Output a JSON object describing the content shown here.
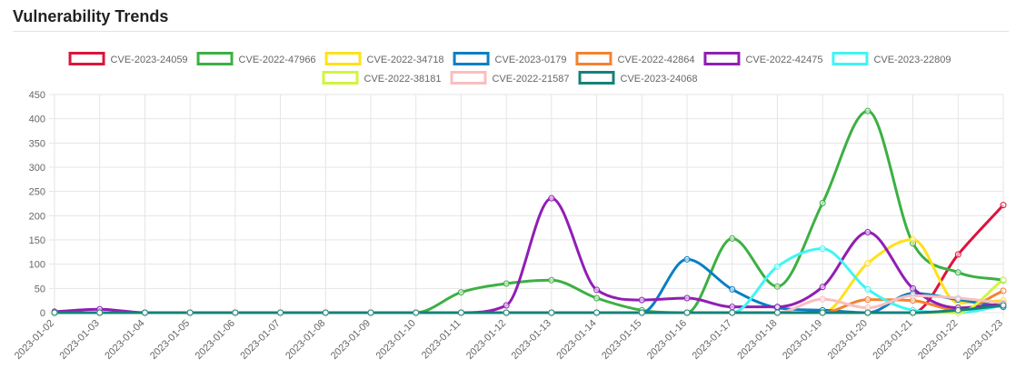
{
  "page": {
    "title": "Vulnerability Trends"
  },
  "chart_data": {
    "type": "line",
    "title": "Vulnerability Trends",
    "xlabel": "",
    "ylabel": "",
    "ylim": [
      0,
      450
    ],
    "yticks": [
      0,
      50,
      100,
      150,
      200,
      250,
      300,
      350,
      400,
      450
    ],
    "grid": true,
    "legend_position": "top",
    "x": [
      "2023-01-02",
      "2023-01-03",
      "2023-01-04",
      "2023-01-05",
      "2023-01-06",
      "2023-01-07",
      "2023-01-08",
      "2023-01-09",
      "2023-01-10",
      "2023-01-11",
      "2023-01-12",
      "2023-01-13",
      "2023-01-14",
      "2023-01-15",
      "2023-01-16",
      "2023-01-17",
      "2023-01-18",
      "2023-01-19",
      "2023-01-20",
      "2023-01-21",
      "2023-01-22",
      "2023-01-23"
    ],
    "series": [
      {
        "name": "CVE-2023-24059",
        "color": "#dc143c",
        "values": [
          0,
          0,
          0,
          0,
          0,
          0,
          0,
          0,
          0,
          0,
          0,
          0,
          0,
          0,
          0,
          0,
          0,
          0,
          0,
          0,
          120,
          222
        ]
      },
      {
        "name": "CVE-2022-47966",
        "color": "#3cb043",
        "values": [
          0,
          0,
          0,
          0,
          0,
          0,
          0,
          0,
          0,
          42,
          60,
          67,
          30,
          5,
          0,
          153,
          54,
          226,
          416,
          143,
          83,
          67
        ]
      },
      {
        "name": "CVE-2022-34718",
        "color": "#ffe119",
        "values": [
          0,
          0,
          0,
          0,
          0,
          0,
          0,
          0,
          0,
          0,
          0,
          0,
          0,
          0,
          0,
          0,
          0,
          0,
          102,
          151,
          20,
          25
        ]
      },
      {
        "name": "CVE-2023-0179",
        "color": "#0a7fc2",
        "values": [
          0,
          0,
          0,
          0,
          0,
          0,
          0,
          0,
          0,
          0,
          0,
          0,
          0,
          0,
          110,
          48,
          10,
          5,
          0,
          40,
          27,
          12
        ]
      },
      {
        "name": "CVE-2022-42864",
        "color": "#f58231",
        "values": [
          0,
          0,
          0,
          0,
          0,
          0,
          0,
          0,
          0,
          0,
          0,
          0,
          0,
          0,
          0,
          0,
          0,
          0,
          27,
          25,
          5,
          45
        ]
      },
      {
        "name": "CVE-2022-42475",
        "color": "#911eb4",
        "values": [
          2,
          7,
          0,
          0,
          0,
          0,
          0,
          0,
          0,
          0,
          15,
          236,
          47,
          26,
          30,
          12,
          12,
          53,
          166,
          50,
          10,
          18
        ]
      },
      {
        "name": "CVE-2023-22809",
        "color": "#42f4f4",
        "values": [
          0,
          0,
          0,
          0,
          0,
          0,
          0,
          0,
          0,
          0,
          0,
          0,
          0,
          0,
          0,
          0,
          95,
          132,
          48,
          5,
          0,
          15
        ]
      },
      {
        "name": "CVE-2022-38181",
        "color": "#d2f53c",
        "values": [
          0,
          0,
          0,
          0,
          0,
          0,
          0,
          0,
          0,
          0,
          0,
          0,
          0,
          0,
          0,
          0,
          0,
          0,
          0,
          0,
          0,
          68
        ]
      },
      {
        "name": "CVE-2022-21587",
        "color": "#fabebe",
        "values": [
          0,
          0,
          0,
          0,
          0,
          0,
          0,
          0,
          0,
          0,
          0,
          0,
          0,
          0,
          0,
          0,
          0,
          28,
          10,
          35,
          30,
          20
        ]
      },
      {
        "name": "CVE-2023-24068",
        "color": "#16817a",
        "values": [
          0,
          0,
          0,
          0,
          0,
          0,
          0,
          0,
          0,
          0,
          0,
          0,
          0,
          0,
          0,
          0,
          0,
          0,
          0,
          0,
          5,
          15
        ]
      }
    ]
  }
}
